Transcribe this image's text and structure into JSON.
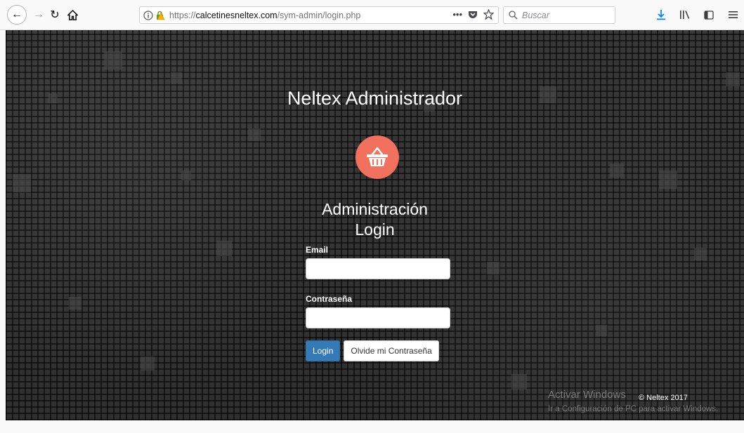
{
  "browser": {
    "url_prefix": "https://",
    "url_host": "calcetinesneltex.com",
    "url_path": "/sym-admin/login.php",
    "search_placeholder": "Buscar",
    "more_label": "•••"
  },
  "page": {
    "brand_title": "Neltex Administrador",
    "subtitle_line1": "Administración",
    "subtitle_line2": "Login",
    "email_label": "Email",
    "password_label": "Contraseña",
    "login_button": "Login",
    "forgot_button": "Olvide mi Contraseña",
    "copyright": "© Neltex 2017",
    "logo_color": "#f2705e",
    "primary_color": "#337ab7"
  },
  "os_overlay": {
    "watermark_title": "Activar Windows",
    "watermark_sub": "Ir a Configuración de PC para activar Windows."
  }
}
